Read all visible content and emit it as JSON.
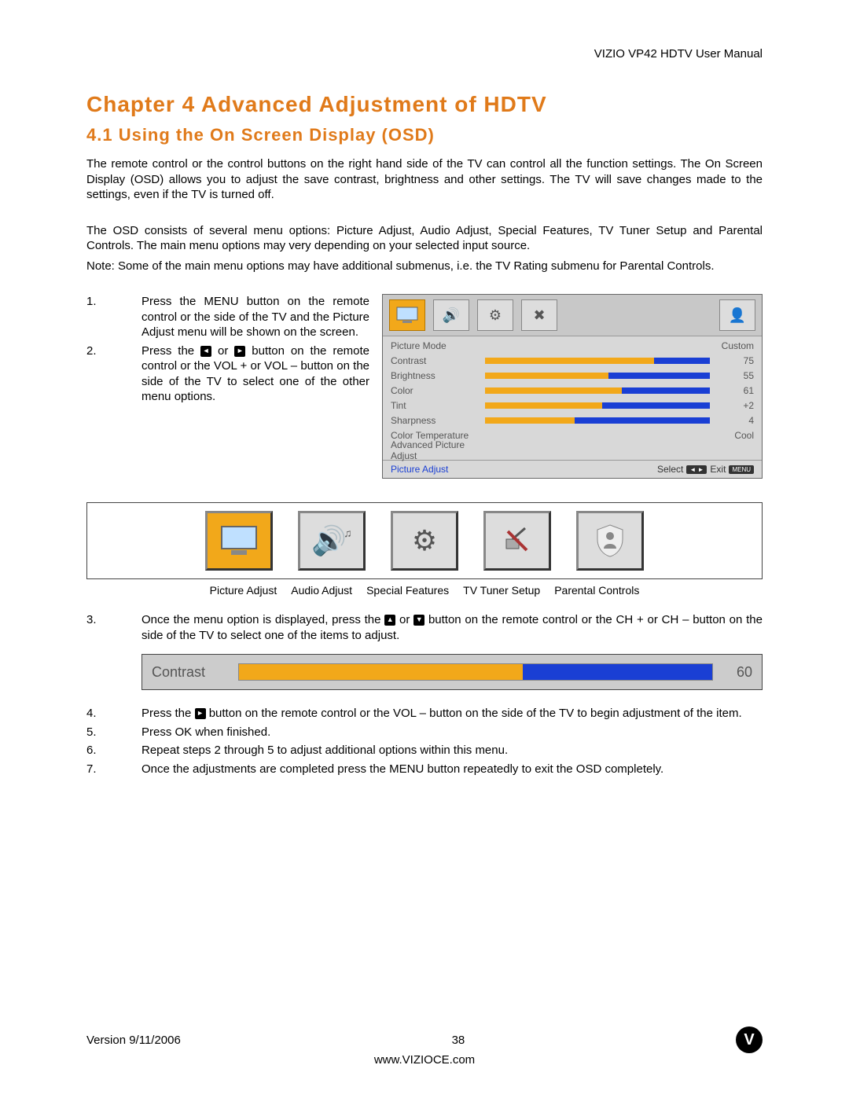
{
  "header": {
    "manualTitle": "VIZIO VP42 HDTV User Manual"
  },
  "chapter": {
    "title": "Chapter 4 Advanced Adjustment of HDTV",
    "section": "4.1 Using the On Screen Display (OSD)"
  },
  "paras": {
    "p1": "The remote control or the control buttons on the right hand side of the TV can control all the function settings.  The On Screen Display (OSD) allows you to adjust the save contrast, brightness and other settings.  The TV will save changes made to the settings, even if the TV is turned off.",
    "p2": "The OSD consists of several menu options: Picture Adjust, Audio Adjust, Special Features, TV Tuner Setup and Parental Controls.  The main menu options may very depending on your selected input source.",
    "p3": "Note:  Some of the main menu options may have additional submenus, i.e. the TV Rating submenu for Parental Controls."
  },
  "steps": {
    "s1": {
      "n": "1.",
      "t": "Press the MENU button on the remote control or the side of the TV and the Picture Adjust menu will be shown on the screen."
    },
    "s2a": "Press the ",
    "s2mid": " or ",
    "s2b": " button on the remote control or the VOL + or VOL – button on the side of the TV to select one of the other menu options.",
    "s2n": "2.",
    "s3n": "3.",
    "s3a": "Once the menu option is displayed, press the ",
    "s3mid": " or ",
    "s3b": " button on the remote control or the CH + or CH – button on the side of the TV to select one of the items to adjust.",
    "s4n": "4.",
    "s4a": "Press the ",
    "s4b": " button on the remote control or the VOL – button on the side of the TV to begin adjustment of the item.",
    "s5": {
      "n": "5.",
      "t": "Press OK when finished."
    },
    "s6": {
      "n": "6.",
      "t": "Repeat steps 2 through 5 to adjust additional options within this menu."
    },
    "s7": {
      "n": "7.",
      "t": "Once the adjustments are completed press the MENU button repeatedly to exit the OSD completely."
    }
  },
  "osd": {
    "rows": [
      {
        "label": "Picture Mode",
        "value": "Custom",
        "bar": null
      },
      {
        "label": "Contrast",
        "value": "75",
        "bar": 75
      },
      {
        "label": "Brightness",
        "value": "55",
        "bar": 55
      },
      {
        "label": "Color",
        "value": "61",
        "bar": 61
      },
      {
        "label": "Tint",
        "value": "+2",
        "bar": 52
      },
      {
        "label": "Sharpness",
        "value": "4",
        "bar": 40
      },
      {
        "label": "Color Temperature",
        "value": "Cool",
        "bar": null
      },
      {
        "label": "Advanced Picture Adjust",
        "value": "",
        "bar": null
      }
    ],
    "footerLeft": "Picture Adjust",
    "footerSelect": "Select",
    "footerExit": "Exit",
    "keySelect": "◄ ►",
    "keyExit": "MENU"
  },
  "iconLabels": {
    "a": "Picture Adjust",
    "b": "Audio Adjust",
    "c": "Special Features",
    "d": "TV Tuner Setup",
    "e": "Parental Controls"
  },
  "contrastBar": {
    "label": "Contrast",
    "value": "60",
    "fill": 60
  },
  "footer": {
    "version": "Version 9/11/2006",
    "page": "38",
    "url": "www.VIZIOCE.com",
    "logo": "V"
  }
}
